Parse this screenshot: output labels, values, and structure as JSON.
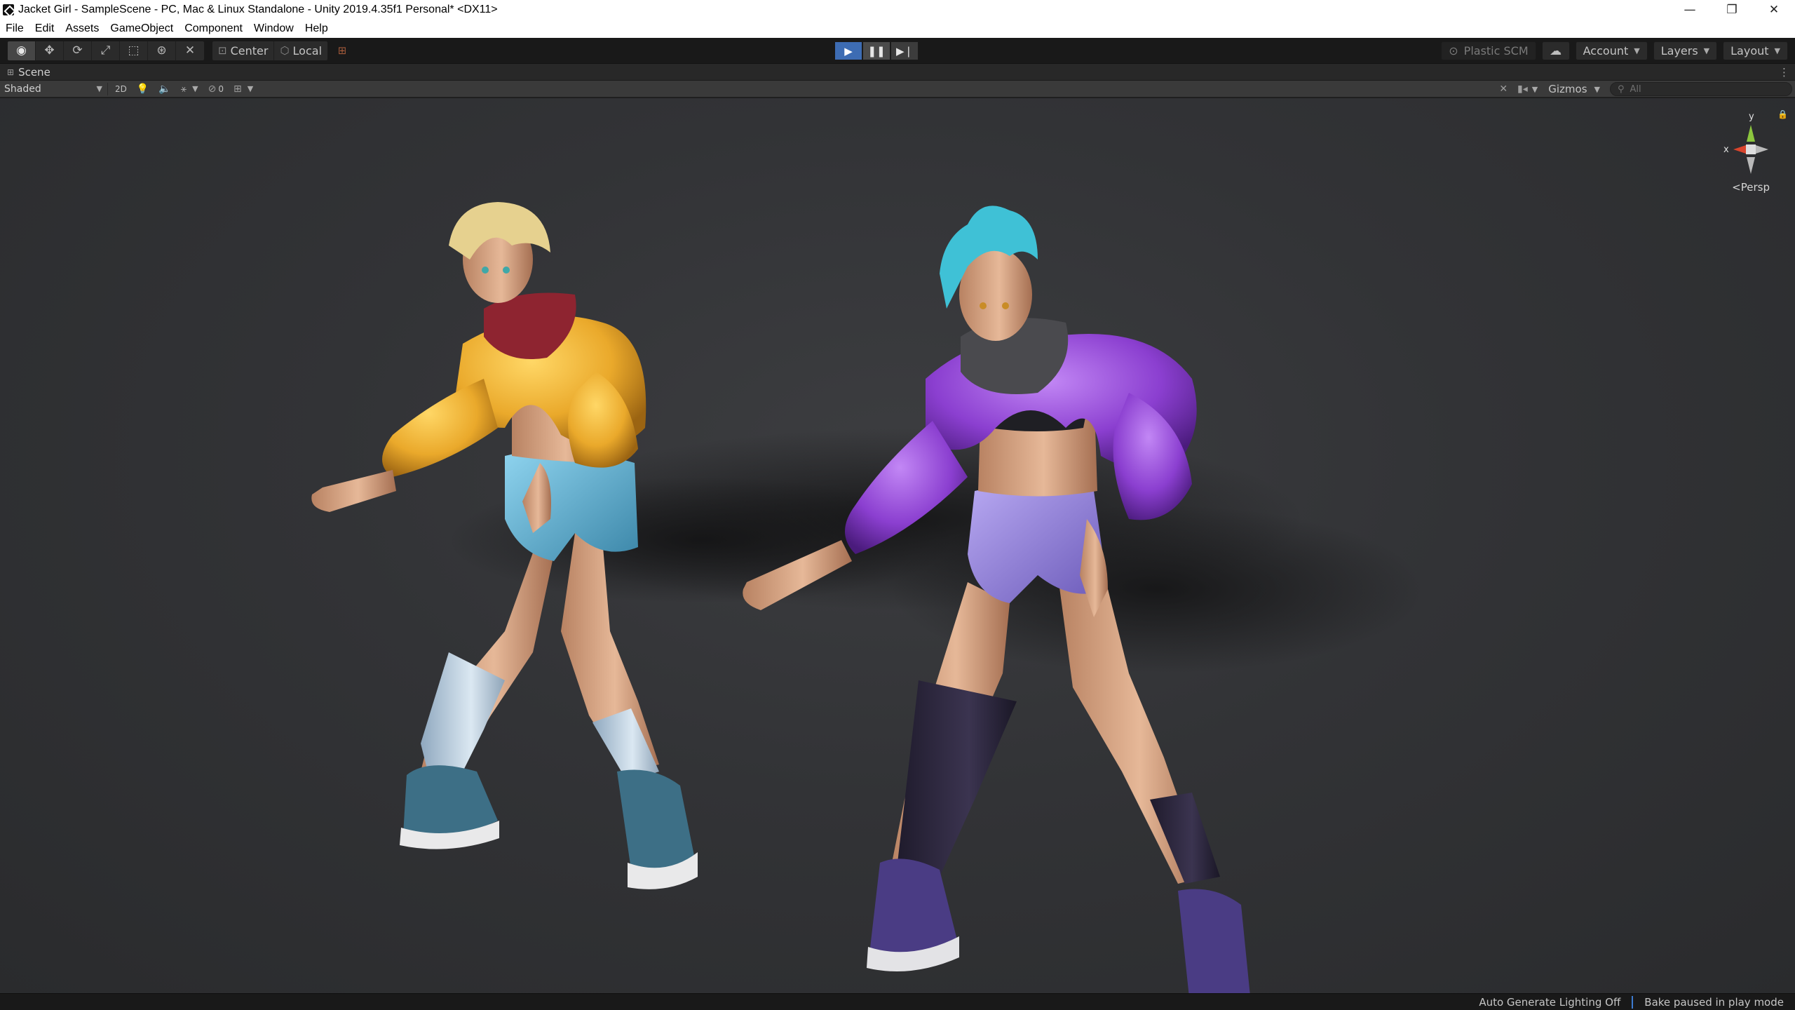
{
  "window": {
    "title": "Jacket Girl - SampleScene - PC, Mac & Linux Standalone - Unity 2019.4.35f1 Personal* <DX11>",
    "controls": {
      "minimize": "—",
      "restore": "❐",
      "close": "✕"
    }
  },
  "menu": {
    "items": [
      "File",
      "Edit",
      "Assets",
      "GameObject",
      "Component",
      "Window",
      "Help"
    ]
  },
  "toolbar": {
    "transform_tools": [
      "view-tool",
      "move-tool",
      "rotate-tool",
      "scale-tool",
      "rect-tool",
      "transform-tool",
      "custom-tool"
    ],
    "pivot_label": "Center",
    "space_label": "Local",
    "plastic_label": "Plastic SCM",
    "account_label": "Account",
    "layers_label": "Layers",
    "layout_label": "Layout"
  },
  "scene": {
    "tab_label": "Scene",
    "shading_mode": "Shaded",
    "mode_2d": "2D",
    "hidden_count": "0",
    "gizmos_label": "Gizmos",
    "search_placeholder": "All",
    "projection_label": "Persp",
    "axis_x": "x",
    "axis_y": "y"
  },
  "status": {
    "lighting": "Auto Generate Lighting Off",
    "bake": "Bake paused in play mode"
  },
  "colors": {
    "play_active": "#3d6cb3",
    "axis_x": "#d9442c",
    "axis_y": "#8cc63e",
    "jacket_left": "#f0b432",
    "jacket_right": "#9a4bd6",
    "hair_right": "#3fc1d6",
    "scarf_left": "#8e2430"
  }
}
